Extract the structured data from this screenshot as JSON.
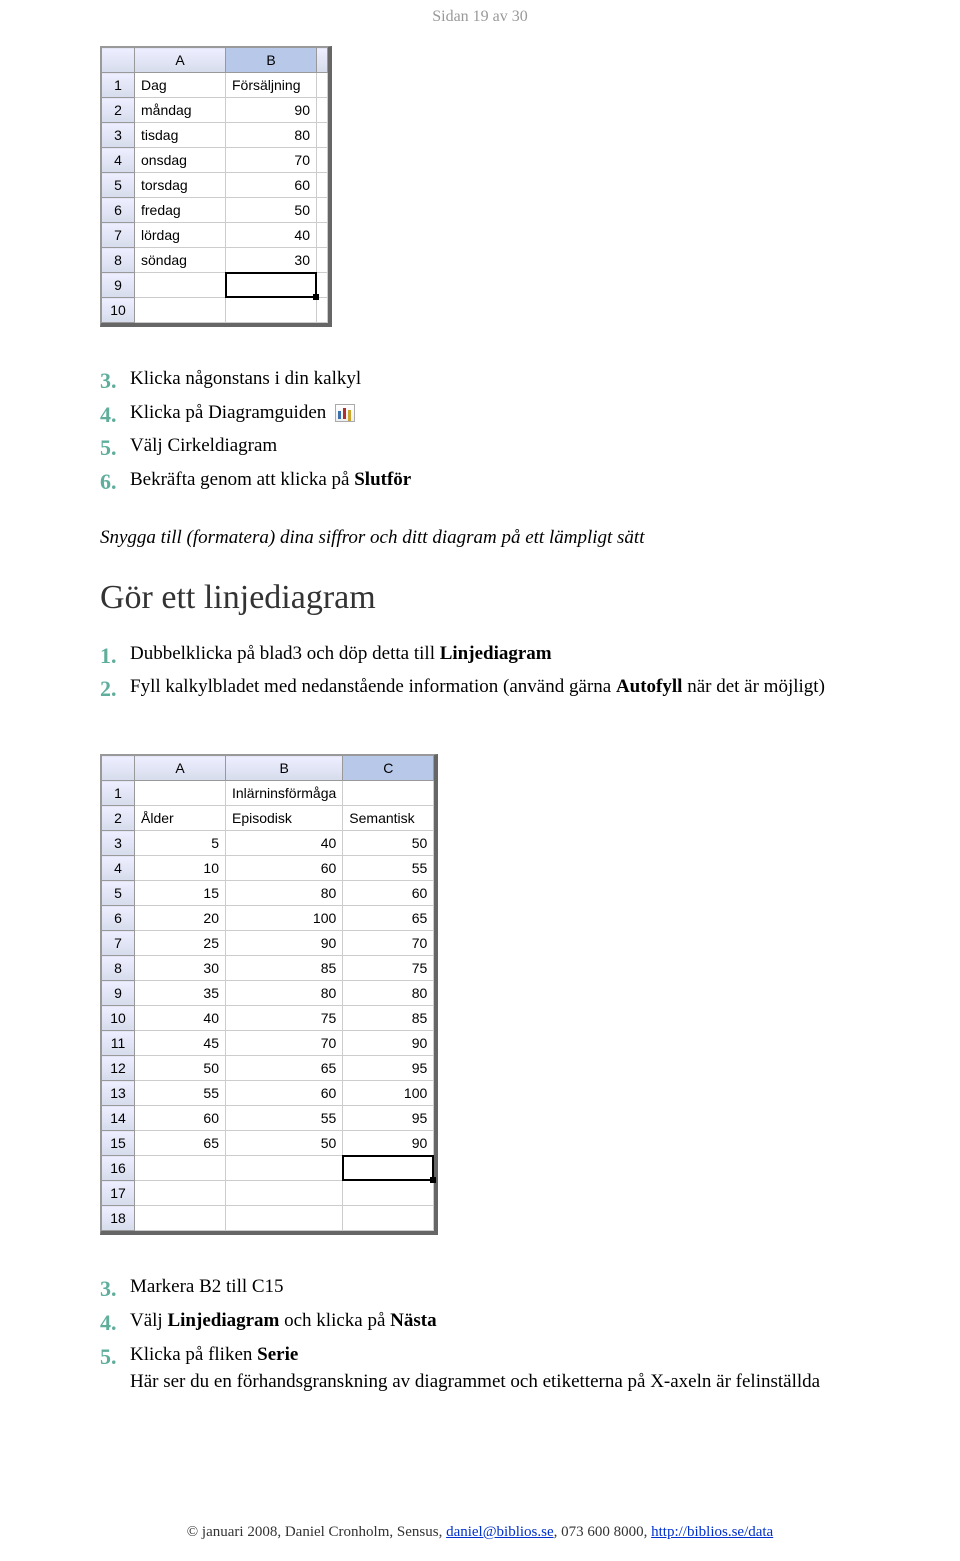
{
  "header": "Sidan 19 av 30",
  "sheet1": {
    "cols": [
      "A",
      "B"
    ],
    "rows": [
      {
        "n": "1",
        "a": "Dag",
        "b": "Försäljning"
      },
      {
        "n": "2",
        "a": "måndag",
        "b": "90"
      },
      {
        "n": "3",
        "a": "tisdag",
        "b": "80"
      },
      {
        "n": "4",
        "a": "onsdag",
        "b": "70"
      },
      {
        "n": "5",
        "a": "torsdag",
        "b": "60"
      },
      {
        "n": "6",
        "a": "fredag",
        "b": "50"
      },
      {
        "n": "7",
        "a": "lördag",
        "b": "40"
      },
      {
        "n": "8",
        "a": "söndag",
        "b": "30"
      },
      {
        "n": "9",
        "a": "",
        "b": ""
      },
      {
        "n": "10",
        "a": "",
        "b": ""
      }
    ]
  },
  "stepsA": [
    {
      "n": "3.",
      "pre": "Klicka någonstans i din kalkyl"
    },
    {
      "n": "4.",
      "pre": "Klicka på Diagramguiden ",
      "icon": true
    },
    {
      "n": "5.",
      "pre": "Välj Cirkeldiagram"
    },
    {
      "n": "6.",
      "pre": "Bekräfta genom att klicka på ",
      "bold": "Slutför"
    }
  ],
  "italicLine": "Snygga till (formatera) dina siffror och ditt diagram på ett lämpligt sätt",
  "section": "Gör ett linjediagram",
  "stepsB": [
    {
      "n": "1.",
      "pre": "Dubbelklicka på blad3 och döp detta till ",
      "bold": "Linjediagram"
    },
    {
      "n": "2.",
      "pre": "Fyll kalkylbladet med nedanstående information (använd gärna ",
      "bold": "Autofyll",
      "post": " när det är möjligt)"
    }
  ],
  "sheet2": {
    "cols": [
      "A",
      "B",
      "C"
    ],
    "rows": [
      {
        "n": "1",
        "a": "",
        "b": "Inlärninsförmåga",
        "c": ""
      },
      {
        "n": "2",
        "a": "Ålder",
        "b": "Episodisk",
        "c": "Semantisk"
      },
      {
        "n": "3",
        "a": "5",
        "b": "40",
        "c": "50"
      },
      {
        "n": "4",
        "a": "10",
        "b": "60",
        "c": "55"
      },
      {
        "n": "5",
        "a": "15",
        "b": "80",
        "c": "60"
      },
      {
        "n": "6",
        "a": "20",
        "b": "100",
        "c": "65"
      },
      {
        "n": "7",
        "a": "25",
        "b": "90",
        "c": "70"
      },
      {
        "n": "8",
        "a": "30",
        "b": "85",
        "c": "75"
      },
      {
        "n": "9",
        "a": "35",
        "b": "80",
        "c": "80"
      },
      {
        "n": "10",
        "a": "40",
        "b": "75",
        "c": "85"
      },
      {
        "n": "11",
        "a": "45",
        "b": "70",
        "c": "90"
      },
      {
        "n": "12",
        "a": "50",
        "b": "65",
        "c": "95"
      },
      {
        "n": "13",
        "a": "55",
        "b": "60",
        "c": "100"
      },
      {
        "n": "14",
        "a": "60",
        "b": "55",
        "c": "95"
      },
      {
        "n": "15",
        "a": "65",
        "b": "50",
        "c": "90"
      },
      {
        "n": "16",
        "a": "",
        "b": "",
        "c": ""
      },
      {
        "n": "17",
        "a": "",
        "b": "",
        "c": ""
      },
      {
        "n": "18",
        "a": "",
        "b": "",
        "c": ""
      }
    ]
  },
  "stepsC": [
    {
      "n": "3.",
      "pre": "Markera B2 till C15"
    },
    {
      "n": "4.",
      "pre": "Välj ",
      "bold": "Linjediagram",
      "post": " och klicka på ",
      "bold2": "Nästa"
    },
    {
      "n": "5.",
      "pre": "Klicka på fliken ",
      "bold": "Serie",
      "note": "Här ser du en förhandsgranskning av diagrammet och etiketterna på X-axeln är felinställda"
    }
  ],
  "footer": {
    "pre": "© januari 2008, Daniel Cronholm, Sensus, ",
    "email": "daniel@biblios.se",
    "mid": ", 073 600 8000, ",
    "url": "http://biblios.se/data"
  }
}
